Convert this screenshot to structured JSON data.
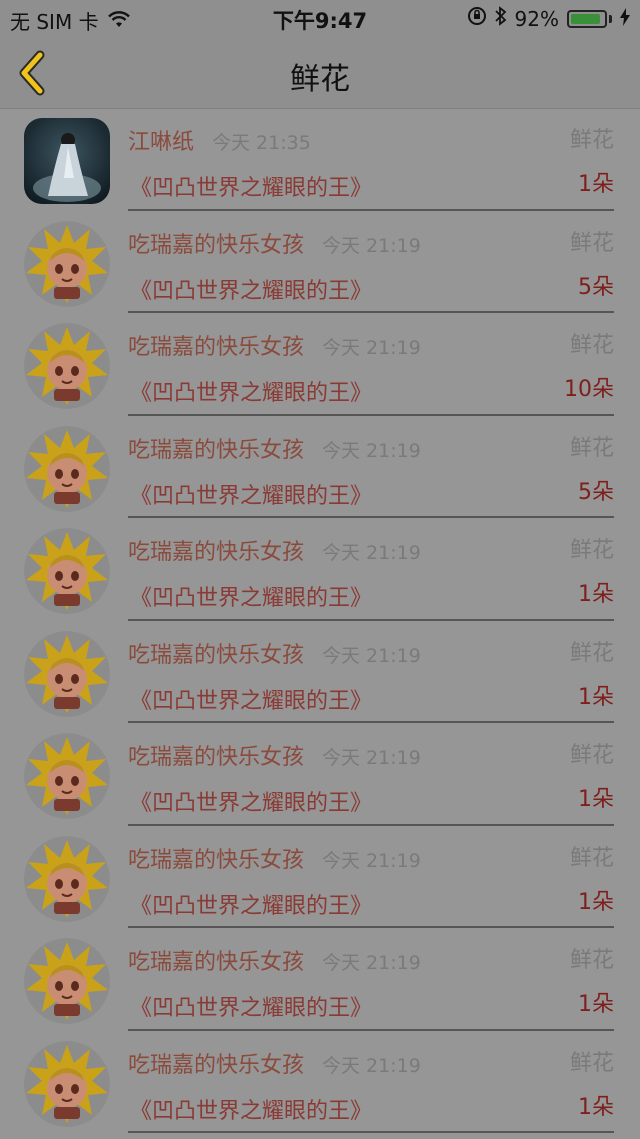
{
  "status_bar": {
    "carrier": "无 SIM 卡",
    "time": "下午9:47",
    "battery_percent": "92%",
    "battery_level": 0.92,
    "icons": [
      "wifi-icon",
      "orientation-lock-icon",
      "bluetooth-icon",
      "charging-icon"
    ]
  },
  "nav": {
    "title": "鲜花",
    "back_icon": "chevron-left-icon",
    "accent": "#f0c419"
  },
  "items": [
    {
      "user": "江啉纸",
      "time": "今天 21:35",
      "type": "鲜花",
      "book": "《凹凸世界之耀眼的王》",
      "count": "1朵",
      "avatar": "photo"
    },
    {
      "user": "吃瑞嘉的快乐女孩",
      "time": "今天 21:19",
      "type": "鲜花",
      "book": "《凹凸世界之耀眼的王》",
      "count": "5朵",
      "avatar": "anime"
    },
    {
      "user": "吃瑞嘉的快乐女孩",
      "time": "今天 21:19",
      "type": "鲜花",
      "book": "《凹凸世界之耀眼的王》",
      "count": "10朵",
      "avatar": "anime"
    },
    {
      "user": "吃瑞嘉的快乐女孩",
      "time": "今天 21:19",
      "type": "鲜花",
      "book": "《凹凸世界之耀眼的王》",
      "count": "5朵",
      "avatar": "anime"
    },
    {
      "user": "吃瑞嘉的快乐女孩",
      "time": "今天 21:19",
      "type": "鲜花",
      "book": "《凹凸世界之耀眼的王》",
      "count": "1朵",
      "avatar": "anime"
    },
    {
      "user": "吃瑞嘉的快乐女孩",
      "time": "今天 21:19",
      "type": "鲜花",
      "book": "《凹凸世界之耀眼的王》",
      "count": "1朵",
      "avatar": "anime"
    },
    {
      "user": "吃瑞嘉的快乐女孩",
      "time": "今天 21:19",
      "type": "鲜花",
      "book": "《凹凸世界之耀眼的王》",
      "count": "1朵",
      "avatar": "anime"
    },
    {
      "user": "吃瑞嘉的快乐女孩",
      "time": "今天 21:19",
      "type": "鲜花",
      "book": "《凹凸世界之耀眼的王》",
      "count": "1朵",
      "avatar": "anime"
    },
    {
      "user": "吃瑞嘉的快乐女孩",
      "time": "今天 21:19",
      "type": "鲜花",
      "book": "《凹凸世界之耀眼的王》",
      "count": "1朵",
      "avatar": "anime"
    },
    {
      "user": "吃瑞嘉的快乐女孩",
      "time": "今天 21:19",
      "type": "鲜花",
      "book": "《凹凸世界之耀眼的王》",
      "count": "1朵",
      "avatar": "anime"
    }
  ]
}
